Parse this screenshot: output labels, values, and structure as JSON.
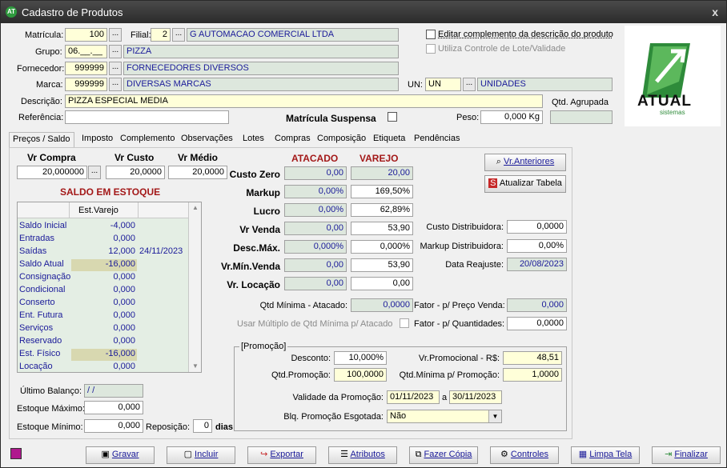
{
  "window": {
    "title": "Cadastro de Produtos",
    "close": "x",
    "app_icon": "AT"
  },
  "header": {
    "matricula_label": "Matrícula:",
    "matricula": "100",
    "filial_label": "Filial:",
    "filial": "2",
    "filial_name": "G AUTOMACAO COMERCIAL LTDA",
    "grupo_label": "Grupo:",
    "grupo": "06.__.__",
    "grupo_name": "PIZZA",
    "fornecedor_label": "Fornecedor:",
    "fornecedor": "999999",
    "fornecedor_name": "FORNECEDORES DIVERSOS",
    "marca_label": "Marca:",
    "marca": "999999",
    "marca_name": "DIVERSAS MARCAS",
    "un_label": "UN:",
    "un": "UN",
    "un_name": "UNIDADES",
    "descricao_label": "Descrição:",
    "descricao": "PIZZA ESPECIAL MEDIA",
    "referencia_label": "Referência:",
    "referencia": "",
    "matricula_suspensa_label": "Matrícula Suspensa",
    "peso_label": "Peso:",
    "peso": "0,000 Kg",
    "qtd_agrupada_label": "Qtd. Agrupada",
    "editar_complemento_label": "Editar complemento da descrição do produto",
    "lote_validade_label": "Utiliza Controle de Lote/Validade",
    "dots": "...",
    "logo_text": "ATUAL",
    "logo_sub": "sistemas"
  },
  "tabs": [
    "Preços / Saldo",
    "Imposto",
    "Complemento",
    "Observações",
    "Lotes",
    "Compras",
    "Composição",
    "Etiqueta",
    "Pendências"
  ],
  "prices": {
    "vr_compra_label": "Vr Compra",
    "vr_custo_label": "Vr Custo",
    "vr_medio_label": "Vr Médio",
    "vr_compra": "20,000000",
    "vr_custo": "20,0000",
    "vr_medio": "20,0000"
  },
  "pricing": {
    "atacado_label": "ATACADO",
    "varejo_label": "VAREJO",
    "rows": [
      {
        "label": "Custo Zero",
        "atacado": "0,00",
        "varejo": "20,00"
      },
      {
        "label": "Markup",
        "atacado": "0,00%",
        "varejo": "169,50%"
      },
      {
        "label": "Lucro",
        "atacado": "0,00%",
        "varejo": "62,89%"
      },
      {
        "label": "Vr Venda",
        "atacado": "0,00",
        "varejo": "53,90"
      },
      {
        "label": "Desc.Máx.",
        "atacado": "0,000%",
        "varejo": "0,000%"
      },
      {
        "label": "Vr.Mín.Venda",
        "atacado": "0,00",
        "varejo": "53,90"
      },
      {
        "label": "Vr. Locação",
        "atacado": "0,00",
        "varejo": "0,00"
      }
    ]
  },
  "right_fields": {
    "vr_anteriores": "Vr.Anteriores",
    "atualizar_tabela": "Atualizar Tabela",
    "custo_dist_label": "Custo Distribuidora:",
    "custo_dist": "0,0000",
    "markup_dist_label": "Markup Distribuidora:",
    "markup_dist": "0,00%",
    "data_reajuste_label": "Data Reajuste:",
    "data_reajuste": "20/08/2023",
    "qtd_min_atacado_label": "Qtd Mínima - Atacado:",
    "qtd_min_atacado": "0,0000",
    "fator_preco_label": "Fator - p/ Preço Venda:",
    "fator_preco": "0,000",
    "usar_multiplo_label": "Usar Múltiplo de Qtd Mínima p/ Atacado",
    "fator_qtd_label": "Fator - p/ Quantidades:",
    "fator_qtd": "0,0000"
  },
  "promocao": {
    "title": "[Promoção]",
    "desconto_label": "Desconto:",
    "desconto": "10,000%",
    "vr_promocional_label": "Vr.Promocional - R$:",
    "vr_promocional": "48,51",
    "qtd_promocao_label": "Qtd.Promoção:",
    "qtd_promocao": "100,0000",
    "qtd_min_promo_label": "Qtd.Mínima p/ Promoção:",
    "qtd_min_promo": "1,0000",
    "validade_label": "Validade da Promoção:",
    "validade_ini": "01/11/2023",
    "a": "a",
    "validade_fim": "30/11/2023",
    "blq_label": "Blq. Promoção Esgotada:",
    "blq": "Não"
  },
  "saldo": {
    "title": "SALDO EM ESTOQUE",
    "col": "Est.Varejo",
    "rows": [
      {
        "k": "Saldo Inicial",
        "v": "-4,000",
        "d": ""
      },
      {
        "k": "Entradas",
        "v": "0,000",
        "d": ""
      },
      {
        "k": "Saídas",
        "v": "12,000",
        "d": "24/11/2023"
      },
      {
        "k": "Saldo Atual",
        "v": "-16,000",
        "d": ""
      },
      {
        "k": "Consignação",
        "v": "0,000",
        "d": ""
      },
      {
        "k": "Condicional",
        "v": "0,000",
        "d": ""
      },
      {
        "k": "Conserto",
        "v": "0,000",
        "d": ""
      },
      {
        "k": "Ent. Futura",
        "v": "0,000",
        "d": ""
      },
      {
        "k": "Serviços",
        "v": "0,000",
        "d": ""
      },
      {
        "k": "Reservado",
        "v": "0,000",
        "d": ""
      },
      {
        "k": "Est. Físico",
        "v": "-16,000",
        "d": ""
      },
      {
        "k": "Locação",
        "v": "0,000",
        "d": ""
      }
    ],
    "ultimo_balanco_label": "Último Balanço:",
    "ultimo_balanco": "/  /",
    "est_max_label": "Estoque Máximo:",
    "est_max": "0,000",
    "est_min_label": "Estoque Mínimo:",
    "est_min": "0,000",
    "reposicao_label": "Reposição:",
    "reposicao": "0",
    "dias": "dias"
  },
  "footer": {
    "gravar": "Gravar",
    "incluir": "Incluir",
    "exportar": "Exportar",
    "atributos": "Atributos",
    "fazer_copia": "Fazer Cópia",
    "controles": "Controles",
    "limpa_tela": "Limpa Tela",
    "finalizar": "Finalizar"
  }
}
